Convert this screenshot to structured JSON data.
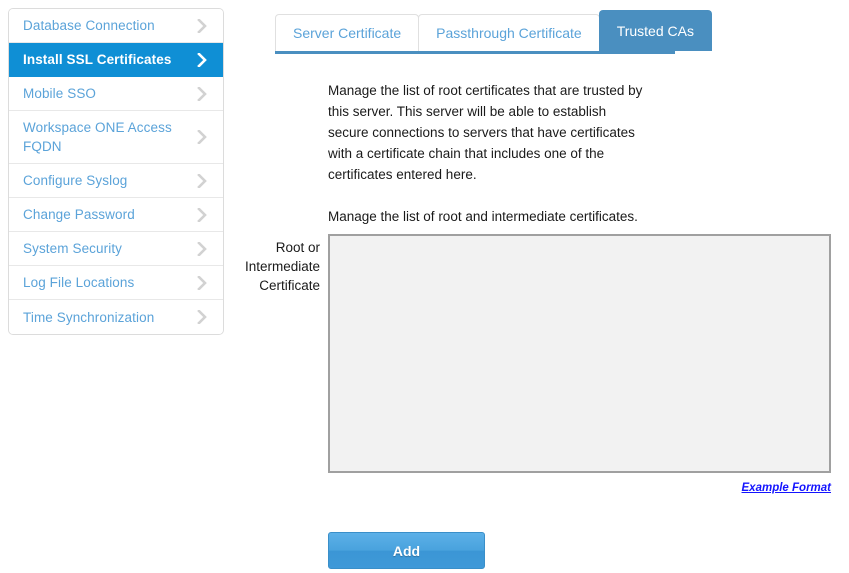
{
  "sidebar": {
    "items": [
      {
        "label": "Database Connection",
        "active": false,
        "icon": "chevron-right-icon"
      },
      {
        "label": "Install SSL Certificates",
        "active": true,
        "icon": "chevron-right-icon"
      },
      {
        "label": "Mobile SSO",
        "active": false,
        "icon": "chevron-right-icon"
      },
      {
        "label": "Workspace ONE Access FQDN",
        "active": false,
        "icon": "chevron-right-icon"
      },
      {
        "label": "Configure Syslog",
        "active": false,
        "icon": "chevron-right-icon"
      },
      {
        "label": "Change Password",
        "active": false,
        "icon": "chevron-right-icon"
      },
      {
        "label": "System Security",
        "active": false,
        "icon": "chevron-right-icon"
      },
      {
        "label": "Log File Locations",
        "active": false,
        "icon": "chevron-right-icon"
      },
      {
        "label": "Time Synchronization",
        "active": false,
        "icon": "chevron-right-icon"
      }
    ]
  },
  "tabs": [
    {
      "label": "Server Certificate",
      "active": false
    },
    {
      "label": "Passthrough Certificate",
      "active": false
    },
    {
      "label": "Trusted CAs",
      "active": true
    }
  ],
  "main": {
    "paragraphs": [
      "Manage the list of root certificates that are trusted by this server. This server will be able to establish secure connections to servers that have certificates with a certificate chain that includes one of the certificates entered here.",
      "Manage the list of root and intermediate certificates."
    ],
    "field_label": "Root or Intermediate Certificate",
    "certificate_value": "",
    "certificate_placeholder": "",
    "example_format_link": "Example Format",
    "add_button": "Add"
  },
  "colors": {
    "sidebar_active": "#0f8fd5",
    "tab_active": "#4a8fc0",
    "link_blue": "#5ba3d9",
    "example_link": "#1414ff",
    "button_blue": "#49a2dd",
    "textarea_bg": "#f2f2f2",
    "textarea_border": "#a0a0a0"
  }
}
